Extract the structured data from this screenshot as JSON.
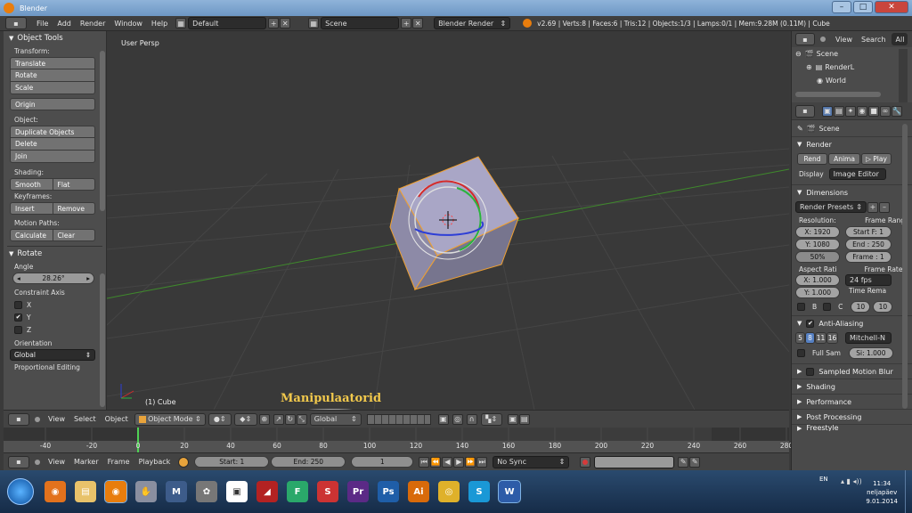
{
  "window": {
    "title": "Blender"
  },
  "info_header": {
    "menus": [
      "File",
      "Add",
      "Render",
      "Window",
      "Help"
    ],
    "screen_layout": "Default",
    "scene": "Scene",
    "render_engine": "Blender Render",
    "stats": "v2.69 | Verts:8 | Faces:6 | Tris:12 | Objects:1/3 | Lamps:0/1 | Mem:9.28M (0.11M) | Cube"
  },
  "tool_shelf": {
    "title": "Object Tools",
    "transform_label": "Transform:",
    "translate": "Translate",
    "rotate": "Rotate",
    "scale": "Scale",
    "origin": "Origin",
    "object_label": "Object:",
    "duplicate": "Duplicate Objects",
    "delete": "Delete",
    "join": "Join",
    "shading_label": "Shading:",
    "smooth": "Smooth",
    "flat": "Flat",
    "keyframes_label": "Keyframes:",
    "insert": "Insert",
    "remove": "Remove",
    "motion_paths_label": "Motion Paths:",
    "calculate": "Calculate",
    "clear": "Clear"
  },
  "operator_panel": {
    "title": "Rotate",
    "angle_label": "Angle",
    "angle_value": "28.26°",
    "constraint_label": "Constraint Axis",
    "axes": [
      {
        "name": "X",
        "checked": false
      },
      {
        "name": "Y",
        "checked": true
      },
      {
        "name": "Z",
        "checked": false
      }
    ],
    "orientation_label": "Orientation",
    "orientation_value": "Global",
    "proportional_label": "Proportional Editing"
  },
  "viewport": {
    "view_label": "User Persp",
    "object_label": "(1) Cube"
  },
  "viewport_header": {
    "menus": [
      "View",
      "Select",
      "Object"
    ],
    "mode": "Object Mode",
    "orientation": "Global",
    "annotation": "Manipulaatorid"
  },
  "timeline": {
    "ticks": [
      "-40",
      "-20",
      "0",
      "20",
      "40",
      "60",
      "80",
      "100",
      "120",
      "140",
      "160",
      "180",
      "200",
      "220",
      "240",
      "260",
      "280"
    ],
    "menus": [
      "View",
      "Marker",
      "Frame",
      "Playback"
    ],
    "start": "Start: 1",
    "end": "End: 250",
    "current": "1",
    "sync": "No Sync"
  },
  "outliner": {
    "menus": [
      "View",
      "Search"
    ],
    "filter": "All",
    "items": [
      "Scene",
      "RenderL",
      "World"
    ]
  },
  "properties": {
    "scene": "Scene",
    "render_title": "Render",
    "render_btn": "Rend",
    "anim_btn": "Anima",
    "play_btn": "Play",
    "display_label": "Display",
    "display_value": "Image Editor",
    "dimensions_title": "Dimensions",
    "presets": "Render Presets",
    "resolution_label": "Resolution:",
    "frame_range_label": "Frame Rang",
    "res_x": "X: 1920",
    "res_y": "Y: 1080",
    "res_pct": "50%",
    "start_frame": "Start F: 1",
    "end_frame": "End : 250",
    "frame_step": "Frame : 1",
    "aspect_label": "Aspect Rati",
    "frame_rate_label": "Frame Rate:",
    "aspect_x": "X: 1.000",
    "aspect_y": "Y: 1.000",
    "fps": "24 fps",
    "time_remap_label": "Time Rema",
    "border_label": "B",
    "crop_label": "C",
    "remap_old": "10",
    "remap_new": "10",
    "aa_title": "Anti-Aliasing",
    "aa_samples": [
      "5",
      "8",
      "11",
      "16"
    ],
    "aa_filter": "Mitchell-N",
    "full_sample": "Full Sam",
    "filter_size": "Si: 1.000",
    "sampled_motion_blur": "Sampled Motion Blur",
    "shading": "Shading",
    "performance": "Performance",
    "post_processing": "Post Processing",
    "freestyle": "Freestyle"
  },
  "taskbar": {
    "apps": [
      "Firefox",
      "Explorer",
      "Blender",
      "Hand",
      "M",
      "GIMP",
      "Files",
      "Filezilla",
      "F",
      "Media",
      "Pr",
      "Ps",
      "Ai",
      "Chrome",
      "S",
      "W"
    ],
    "lang": "EN",
    "time": "11:34",
    "day": "neljapäev",
    "date": "9.01.2014"
  }
}
